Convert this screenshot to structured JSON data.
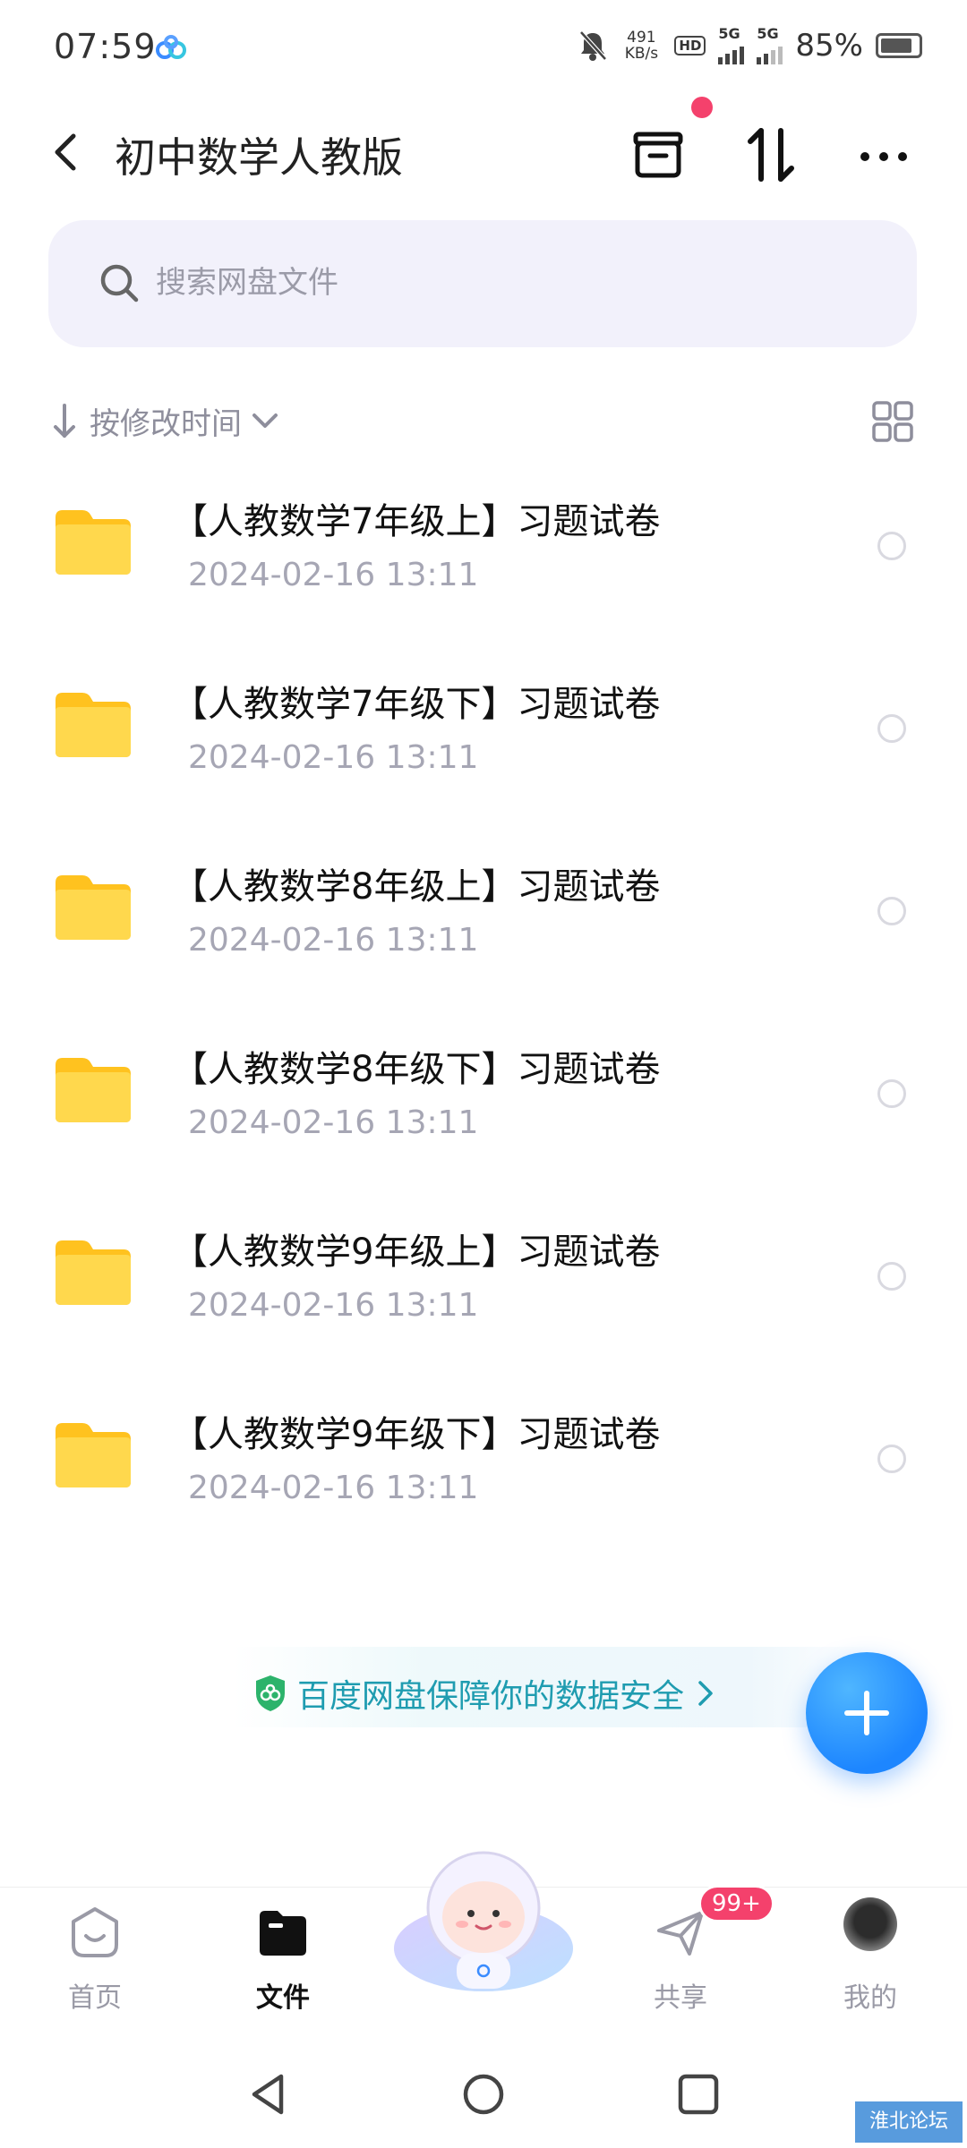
{
  "status_bar": {
    "time": "07:59",
    "net_speed_value": "491",
    "net_speed_unit": "KB/s",
    "hd_tag": "HD",
    "network_1": "5G",
    "network_2": "5G",
    "battery": "85%",
    "battery_level": 0.85
  },
  "header": {
    "title": "初中数学人教版",
    "icons": [
      "back-icon",
      "archive-icon",
      "transfer-icon",
      "more-icon"
    ]
  },
  "search": {
    "placeholder": "搜索网盘文件"
  },
  "sort": {
    "label": "按修改时间",
    "icons": [
      "sort-down-arrow-icon",
      "chevron-down-icon",
      "grid-view-icon"
    ]
  },
  "files": [
    {
      "name": "【人教数学7年级上】习题试卷",
      "date": "2024-02-16  13:11"
    },
    {
      "name": "【人教数学7年级下】习题试卷",
      "date": "2024-02-16  13:11"
    },
    {
      "name": "【人教数学8年级上】习题试卷",
      "date": "2024-02-16  13:11"
    },
    {
      "name": "【人教数学8年级下】习题试卷",
      "date": "2024-02-16  13:11"
    },
    {
      "name": "【人教数学9年级上】习题试卷",
      "date": "2024-02-16  13:11"
    },
    {
      "name": "【人教数学9年级下】习题试卷",
      "date": "2024-02-16  13:11"
    }
  ],
  "banner": {
    "text": "百度网盘保障你的数据安全",
    "color": "#1f9cb0"
  },
  "bottom_nav": {
    "home": "首页",
    "files": "文件",
    "share": "共享",
    "share_badge": "99+",
    "mine": "我的"
  },
  "watermark": "淮北论坛",
  "colors": {
    "accent": "#1d86ff",
    "badge": "#f4416c",
    "folder": "#ffcc33",
    "search_bg": "#f2f1fb"
  }
}
